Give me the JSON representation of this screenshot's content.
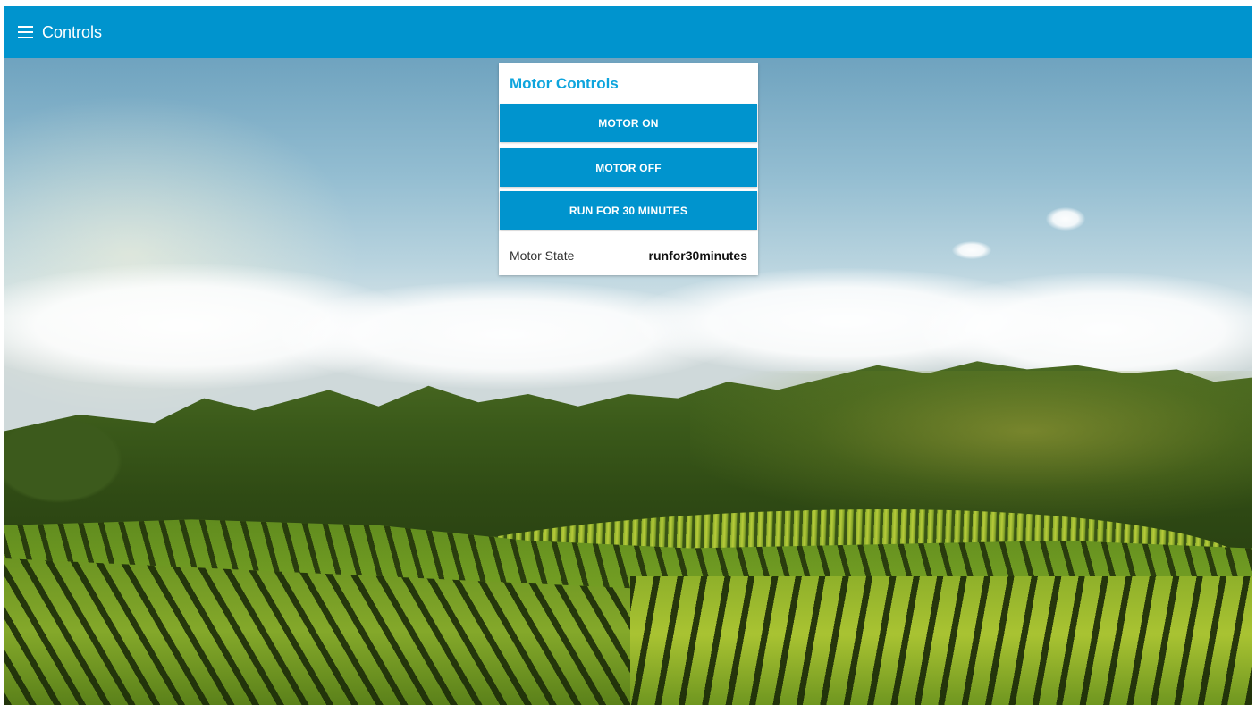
{
  "header": {
    "title": "Controls",
    "menu_icon": "hamburger-menu-icon",
    "bg_color": "#0094ce"
  },
  "card": {
    "title": "Motor Controls",
    "title_color": "#0ea5dd",
    "buttons": [
      {
        "label": "MOTOR ON"
      },
      {
        "label": "MOTOR OFF"
      },
      {
        "label": "RUN FOR 30 MINUTES"
      }
    ],
    "button_color": "#0094ce",
    "state": {
      "label": "Motor State",
      "value": "runfor30minutes"
    }
  }
}
